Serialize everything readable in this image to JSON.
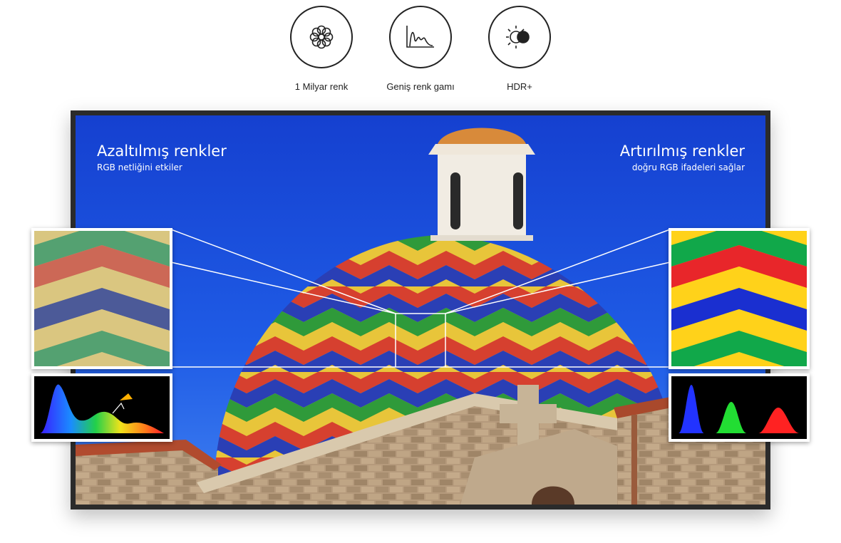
{
  "features": [
    {
      "icon": "flower-icon",
      "label": "1 Milyar renk"
    },
    {
      "icon": "spectrum-graph-icon",
      "label": "Geniş renk gamı"
    },
    {
      "icon": "sun-contrast-icon",
      "label": "HDR+"
    }
  ],
  "left_panel": {
    "title": "Azaltılmış renkler",
    "subtitle": "RGB netliğini etkiler"
  },
  "right_panel": {
    "title": "Artırılmış renkler",
    "subtitle": "doğru RGB ifadeleri sağlar"
  },
  "colors": {
    "sky": "#1a4fd8",
    "frame": "#2b2b2b",
    "icon_stroke": "#222222"
  }
}
